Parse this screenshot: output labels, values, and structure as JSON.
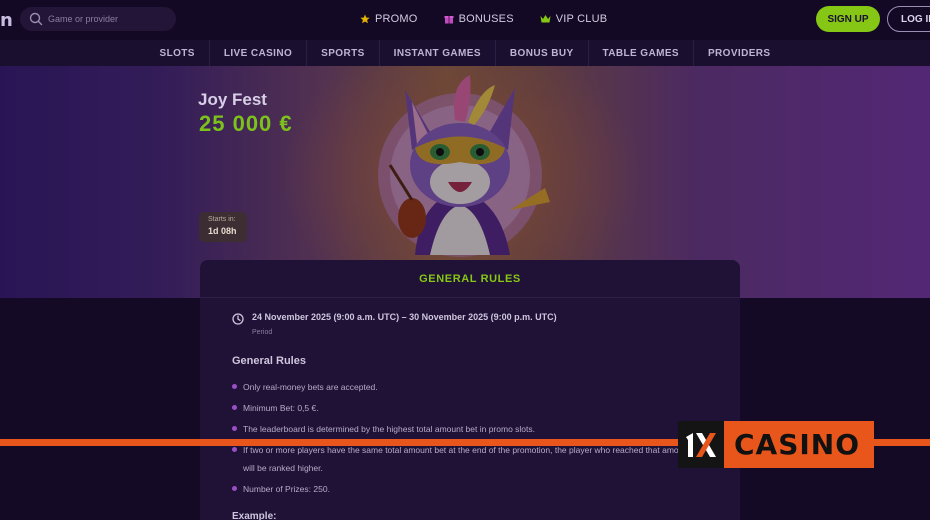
{
  "header": {
    "logo_fragment": "n",
    "search": {
      "placeholder": "Game or provider"
    },
    "nav": [
      {
        "label": "PROMO",
        "icon": "star-icon",
        "color": "#e5b300"
      },
      {
        "label": "BONUSES",
        "icon": "gift-icon",
        "color": "#c04ac0"
      },
      {
        "label": "VIP CLUB",
        "icon": "crown-icon",
        "color": "#86c716"
      }
    ],
    "signup_label": "SIGN UP",
    "login_label": "LOG IN"
  },
  "categories": [
    "SLOTS",
    "LIVE CASINO",
    "SPORTS",
    "INSTANT GAMES",
    "BONUS BUY",
    "TABLE GAMES",
    "PROVIDERS"
  ],
  "hero": {
    "title": "Joy Fest",
    "prize": "25 000 €",
    "starts_label": "Starts in:",
    "starts_value": "1d  08h"
  },
  "rules_card": {
    "heading": "GENERAL RULES",
    "period_dates": "24 November 2025 (9:00 a.m. UTC) – 30 November 2025 (9:00 p.m. UTC)",
    "period_label": "Period",
    "rules_title": "General Rules",
    "rules": [
      "Only real-money bets are accepted.",
      "Minimum Bet: 0,5 €.",
      "The leaderboard is determined by the highest total amount bet in promo slots.",
      "If two or more players have the same total amount bet at the end of the promotion, the player who reached that amount first will be ranked higher.",
      "Number of Prizes: 250."
    ],
    "example_title": "Example:"
  },
  "watermark": {
    "mark": "1X",
    "word": "CASINO"
  },
  "colors": {
    "accent_green": "#86c716",
    "bullet_purple": "#9a4fc6",
    "watermark_orange": "#e8561c"
  }
}
